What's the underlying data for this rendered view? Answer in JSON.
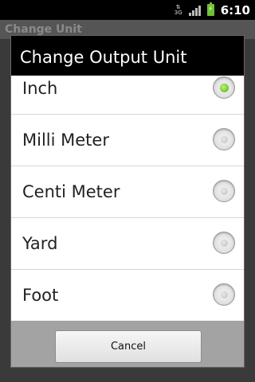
{
  "status_bar": {
    "network": "3G",
    "time": "6:10"
  },
  "background": {
    "title": "Change Unit"
  },
  "dialog": {
    "title": "Change Output Unit",
    "options": [
      {
        "label": "Inch",
        "checked": true
      },
      {
        "label": "Milli Meter",
        "checked": false
      },
      {
        "label": "Centi Meter",
        "checked": false
      },
      {
        "label": "Yard",
        "checked": false
      },
      {
        "label": "Foot",
        "checked": false
      }
    ],
    "cancel_label": "Cancel"
  },
  "colors": {
    "accent": "#6cc42b",
    "title_bar": "#000000",
    "list_background": "#ffffff",
    "button_bar": "#a3a3a3"
  }
}
